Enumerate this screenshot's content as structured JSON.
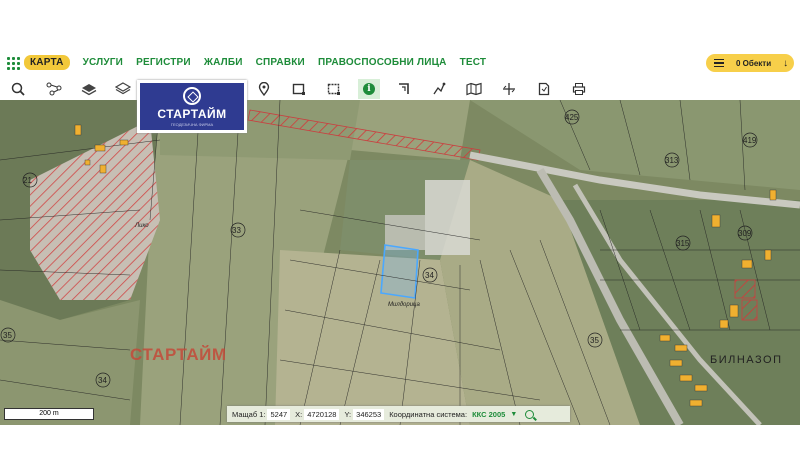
{
  "nav": {
    "items": [
      "КАРТА",
      "УСЛУГИ",
      "РЕГИСТРИ",
      "ЖАЛБИ",
      "СПРАВКИ",
      "ПРАВОСПОСОБНИ ЛИЦА",
      "ТЕСТ"
    ],
    "active_index": 0
  },
  "objects_button": {
    "label": "0 Обекти"
  },
  "toolbar": {
    "tools": [
      "search-icon",
      "topology-icon",
      "layers-icon",
      "layers-stack-icon",
      "location-pin-icon",
      "draw-rectangle-icon",
      "select-area-icon",
      "info-icon",
      "measure-corner-icon",
      "draw-line-icon",
      "map-icon",
      "crosshair-icon",
      "document-icon",
      "print-icon"
    ],
    "active_tool": "info-icon"
  },
  "logo": {
    "name": "СТАРТАЙМ",
    "subtitle": "ГЕОДЕЗИЧНА ФИРМА"
  },
  "map": {
    "watermark": "СТАРТАЙМ",
    "place_name": "БИЛНАЗОП",
    "parcel_numbers": [
      "21",
      "33",
      "34",
      "35",
      "313",
      "315",
      "309",
      "425",
      "419",
      "34",
      "35"
    ],
    "street_labels": [
      "Лико",
      "Милдорица"
    ],
    "highlight_color": "#4aa8ff"
  },
  "scale_bar": {
    "label": "200 m"
  },
  "status": {
    "scale_label": "Мащаб 1:",
    "scale_value": "5247",
    "x_label": "X:",
    "x_value": "4720128",
    "y_label": "Y:",
    "y_value": "346253",
    "crs_label": "Координатна система:",
    "crs_value": "ККС 2005"
  }
}
